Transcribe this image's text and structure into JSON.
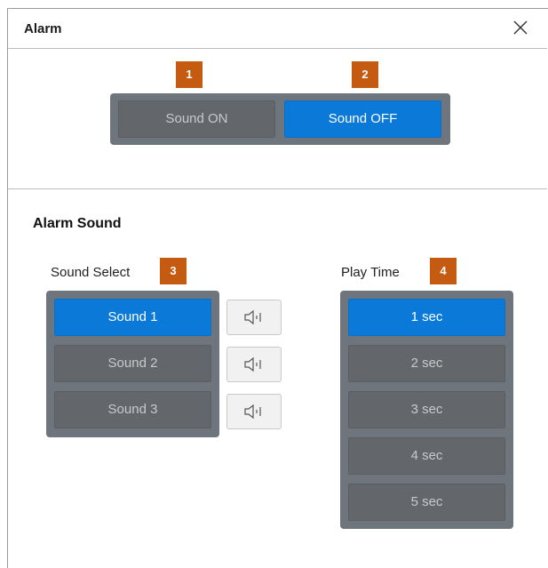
{
  "window": {
    "title": "Alarm"
  },
  "alarm_toggle": {
    "sound_on_label": "Sound ON",
    "sound_off_label": "Sound OFF",
    "selected": "Sound OFF"
  },
  "badges": {
    "b1": "1",
    "b2": "2",
    "b3": "3",
    "b4": "4"
  },
  "alarm_sound": {
    "title": "Alarm Sound",
    "sound_select_label": "Sound Select",
    "play_time_label": "Play Time",
    "sounds": [
      "Sound 1",
      "Sound 2",
      "Sound 3"
    ],
    "selected_sound": "Sound 1",
    "play_times": [
      "1 sec",
      "2 sec",
      "3 sec",
      "4 sec",
      "5 sec"
    ],
    "selected_play_time": "1 sec"
  },
  "colors": {
    "accent": "#0A79D7",
    "badge": "#C55A11",
    "panel": "#6F757C",
    "inactive_button": "#63676B"
  },
  "icons": {
    "close": "close-icon",
    "preview": "speaker-icon"
  }
}
